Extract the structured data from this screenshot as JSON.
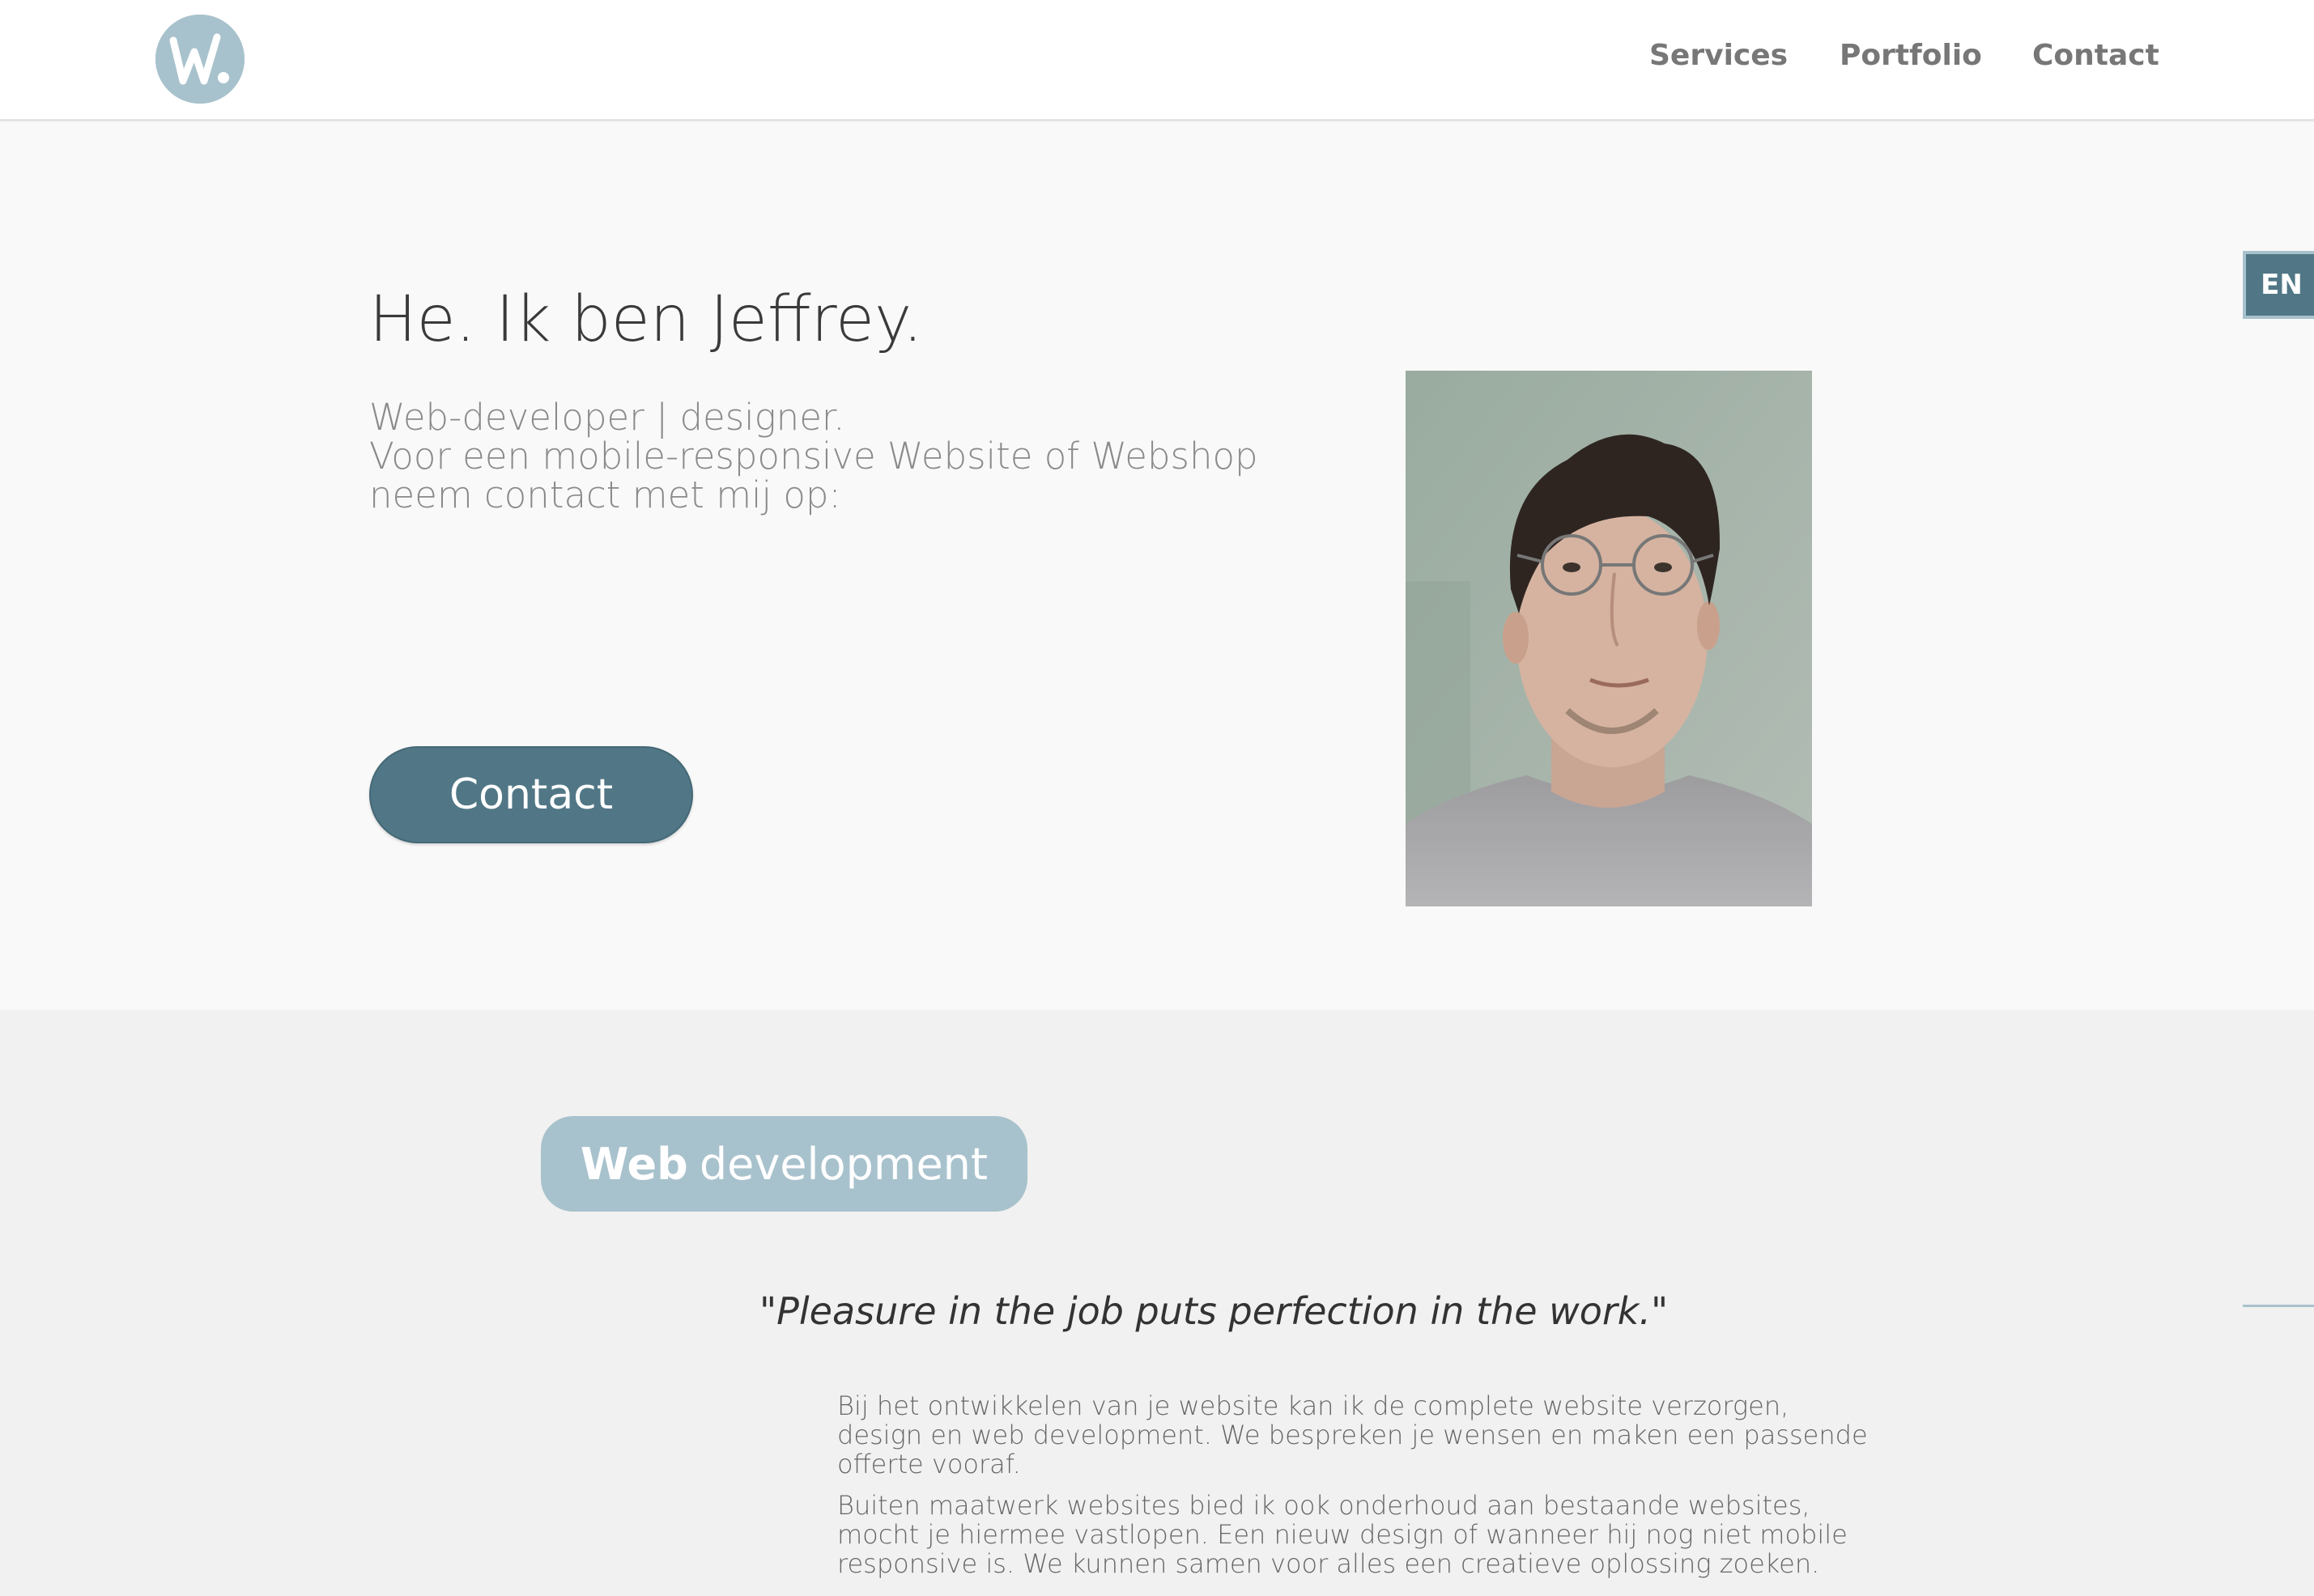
{
  "header": {
    "logo_text": "W.",
    "nav": [
      {
        "label": "Services"
      },
      {
        "label": "Portfolio"
      },
      {
        "label": "Contact"
      }
    ]
  },
  "hero": {
    "title": "He. Ik ben Jeffrey.",
    "subtitle_line1": "Web-developer | designer.",
    "subtitle_line2": "Voor een mobile-responsive Website of Webshop neem contact met mij op:",
    "contact_button": "Contact",
    "language_button": "EN"
  },
  "services": {
    "pill_bold": "Web",
    "pill_rest": "development",
    "quote": "\"Pleasure in the job puts perfection in the work.\"",
    "paragraph1": "Bij het ontwikkelen van je website kan ik de complete website verzorgen, design en web development. We bespreken je wensen en maken een passende offerte vooraf.",
    "paragraph2": "Buiten maatwerk websites bied ik ook onderhoud aan bestaande websites, mocht je hiermee vastlopen. Een nieuw design of wanneer hij nog niet mobile responsive is. We kunnen samen voor alles een creatieve oplossing zoeken."
  },
  "colors": {
    "accent": "#517786",
    "accent_light": "#a8c2cd",
    "nav_text": "#777777",
    "hero_bg": "#f9f9f9",
    "section_bg": "#f1f1f1"
  }
}
